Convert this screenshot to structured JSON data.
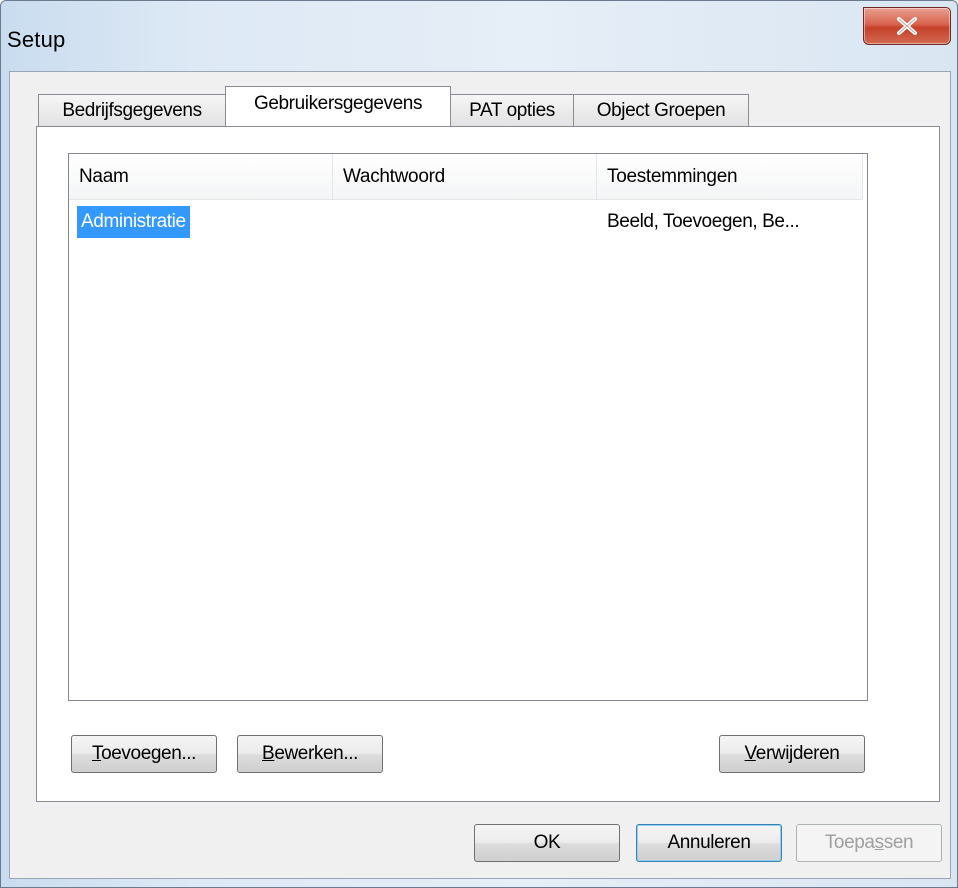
{
  "window": {
    "title": "Setup",
    "close_glyph": "✕"
  },
  "tabs": [
    {
      "label": "Bedrijfsgegevens",
      "active": false
    },
    {
      "label": "Gebruikersgegevens",
      "active": true
    },
    {
      "label": "PAT opties",
      "active": false
    },
    {
      "label": "Object Groepen",
      "active": false
    }
  ],
  "users_list": {
    "columns": [
      "Naam",
      "Wachtwoord",
      "Toestemmingen"
    ],
    "rows": [
      {
        "naam": "Administratie",
        "wachtwoord": "",
        "toestemmingen": "Beeld, Toevoegen, Be...",
        "selected": true
      }
    ]
  },
  "panel_buttons": {
    "add": {
      "mnemonic": "T",
      "rest": "oevoegen..."
    },
    "edit": {
      "mnemonic": "B",
      "rest": "ewerken..."
    },
    "delete": {
      "mnemonic": "V",
      "rest": "erwijderen"
    }
  },
  "dialog_buttons": {
    "ok": "OK",
    "cancel": "Annuleren",
    "apply": {
      "before": "Toepa",
      "mnemonic": "s",
      "after": "sen",
      "disabled": true
    }
  },
  "colors": {
    "selection": "#3399ff",
    "close_button": "#c44129"
  }
}
